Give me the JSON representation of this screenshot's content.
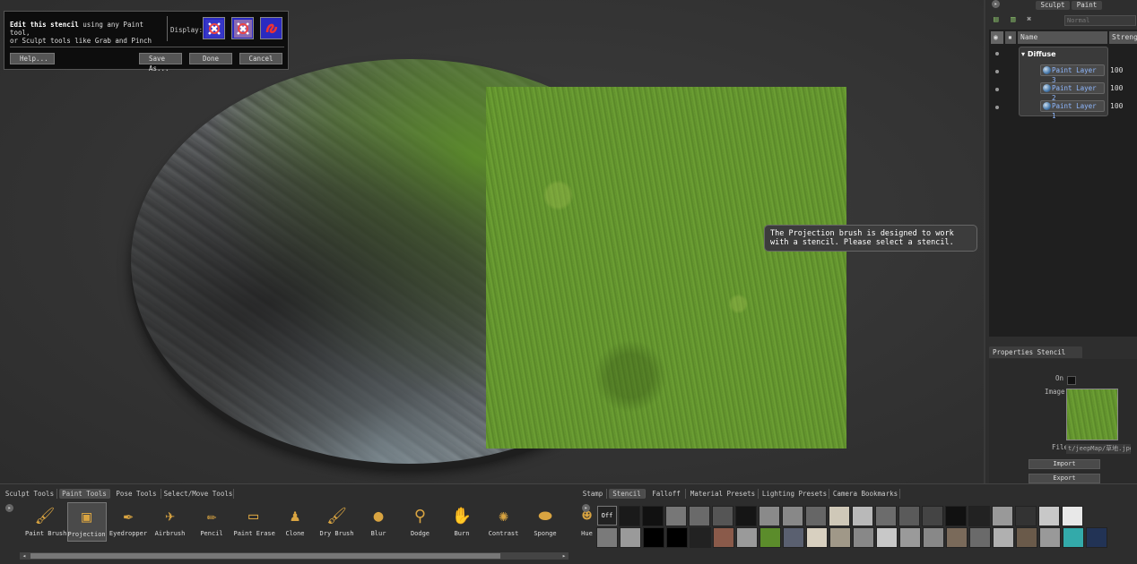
{
  "stencil_panel": {
    "text_bold": "Edit this stencil",
    "text_rest": " using any Paint tool,",
    "text_line2": "or Sculpt tools like Grab and Pinch",
    "display_label": "Display:",
    "buttons": {
      "help": "Help...",
      "save_as": "Save As...",
      "done": "Done",
      "cancel": "Cancel"
    }
  },
  "tooltip": "The Projection brush is designed to work with a stencil. Please select a stencil.",
  "right_panel": {
    "tabs": [
      "Sculpt",
      "Paint"
    ],
    "blend_mode": "Normal",
    "layer_header": {
      "name": "Name",
      "strength": "Strength"
    },
    "group": "Diffuse",
    "layers": [
      {
        "name": "Paint Layer 3",
        "strength": "100"
      },
      {
        "name": "Paint Layer 2",
        "strength": "100"
      },
      {
        "name": "Paint Layer 1",
        "strength": "100"
      }
    ],
    "properties_tab": "Properties  Stencil",
    "props": {
      "on_label": "On",
      "image_label": "Image",
      "file_label": "File",
      "file_value": "t/jeepMap/草地.jpg",
      "import": "Import",
      "export": "Export"
    }
  },
  "bottom": {
    "tool_tabs": [
      "Sculpt Tools",
      "Paint Tools",
      "Pose Tools",
      "Select/Move Tools"
    ],
    "tools": [
      {
        "label": "Paint Brush",
        "icon": "paint-brush-icon",
        "glyph": "🖌"
      },
      {
        "label": "Projection",
        "icon": "projection-icon",
        "glyph": "▣"
      },
      {
        "label": "Eyedropper",
        "icon": "eyedropper-icon",
        "glyph": "✒"
      },
      {
        "label": "Airbrush",
        "icon": "airbrush-icon",
        "glyph": "✈"
      },
      {
        "label": "Pencil",
        "icon": "pencil-icon",
        "glyph": "✏"
      },
      {
        "label": "Paint Erase",
        "icon": "eraser-icon",
        "glyph": "▭"
      },
      {
        "label": "Clone",
        "icon": "clone-stamp-icon",
        "glyph": "♟"
      },
      {
        "label": "Dry Brush",
        "icon": "dry-brush-icon",
        "glyph": "🖌"
      },
      {
        "label": "Blur",
        "icon": "blur-drop-icon",
        "glyph": "●"
      },
      {
        "label": "Dodge",
        "icon": "dodge-icon",
        "glyph": "⚲"
      },
      {
        "label": "Burn",
        "icon": "burn-icon",
        "glyph": "✋"
      },
      {
        "label": "Contrast",
        "icon": "contrast-icon",
        "glyph": "✺"
      },
      {
        "label": "Sponge",
        "icon": "sponge-icon",
        "glyph": "⬬"
      },
      {
        "label": "Hue",
        "icon": "hue-icon",
        "glyph": "☻"
      }
    ],
    "tray_tabs": [
      "Stamp",
      "Stencil",
      "Falloff",
      "Material Presets",
      "Lighting Presets",
      "Camera Bookmarks"
    ],
    "tray_off": "Off",
    "tray_swatches_row1": [
      "#1a1a1a",
      "#111",
      "#777",
      "#6a6a6a",
      "#555",
      "#151515",
      "#8a8a8a",
      "#888",
      "#666",
      "#cfc8b8",
      "#b9b9b9",
      "#6c6c6c",
      "#5a5a5a",
      "#444",
      "#111",
      "#222",
      "#999",
      "#333",
      "#c8c8c8",
      "#e8e8e8"
    ],
    "tray_swatches_row2": [
      "#7a7a7a",
      "#9a9a9a",
      "#000",
      "#000",
      "#222",
      "#8a5a4a",
      "#9a9a9a",
      "#5b8c2b",
      "#5a6070",
      "#d8d0c0",
      "#a09888",
      "#888",
      "#c8c8c8",
      "#9a9a9a",
      "#888",
      "#7a6a5a",
      "#6a6a6a",
      "#b0b0b0",
      "#6a5a4a",
      "#999",
      "#3aa",
      "#235"
    ]
  },
  "colors": {
    "accent_blue": "#2a2ac0",
    "grass": "#659a30",
    "layer_text": "#8fb8ff"
  }
}
